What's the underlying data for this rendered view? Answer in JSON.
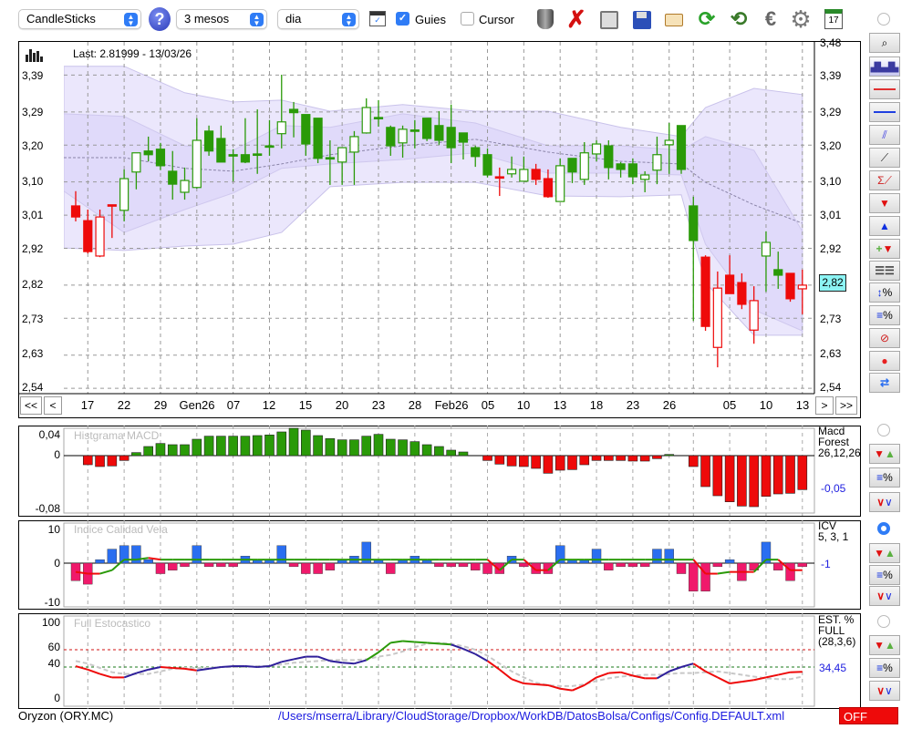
{
  "toolbar": {
    "chart_type": "CandleSticks",
    "period": "3 mesos",
    "interval": "dia",
    "guides_label": "Guies",
    "guides_checked": true,
    "cursor_label": "Cursor",
    "cursor_checked": false,
    "icons": [
      "help-icon",
      "chart-window-icon",
      "trash-icon",
      "delete-icon",
      "snapshot-icon",
      "save-icon",
      "folder-icon",
      "refresh-icon",
      "update-icon",
      "euro-icon",
      "gear-icon",
      "calendar-icon"
    ],
    "calendar_day": "17"
  },
  "main": {
    "last": "Last: 2.81999 - 13/03/26",
    "current_price": "2,82",
    "price_labels": [
      "3,48",
      "3,39",
      "3,29",
      "3,20",
      "3,10",
      "3,01",
      "2,92",
      "2,82",
      "2,73",
      "2,63",
      "2,54"
    ],
    "nav": {
      "first": "<<",
      "prev": "<",
      "next": ">",
      "last": ">>"
    },
    "x_labels": [
      {
        "i": 2,
        "t": "17"
      },
      {
        "i": 5,
        "t": "22"
      },
      {
        "i": 8,
        "t": "29"
      },
      {
        "i": 11,
        "t": "Gen26"
      },
      {
        "i": 14,
        "t": "07"
      },
      {
        "i": 17,
        "t": "12"
      },
      {
        "i": 20,
        "t": "15"
      },
      {
        "i": 23,
        "t": "20"
      },
      {
        "i": 26,
        "t": "23"
      },
      {
        "i": 29,
        "t": "28"
      },
      {
        "i": 32,
        "t": "Feb26"
      },
      {
        "i": 35,
        "t": "05"
      },
      {
        "i": 38,
        "t": "10"
      },
      {
        "i": 41,
        "t": "13"
      },
      {
        "i": 44,
        "t": "18"
      },
      {
        "i": 47,
        "t": "23"
      },
      {
        "i": 50,
        "t": "26"
      },
      {
        "i": 52,
        "t": ""
      },
      {
        "i": 55,
        "t": "05"
      },
      {
        "i": 58,
        "t": "10"
      },
      {
        "i": 61,
        "t": "13"
      }
    ]
  },
  "colors": {
    "up": "#2a9a08",
    "down": "#ee0a0a",
    "band_outer": "#ebe7fc",
    "band_inner": "#e0dafa",
    "icv_pos": "#2a6ef0",
    "icv_neg": "#f0196b",
    "stoch_blue": "#2e1f9a",
    "accent": "#2f7cf6",
    "off": "#ee0a0a"
  },
  "chart_data": [
    {
      "type": "candlestick",
      "title": "CandleSticks",
      "ylim": [
        2.528,
        3.48
      ],
      "candle_format": [
        "open",
        "high",
        "low",
        "close",
        "style"
      ],
      "candles": [
        [
          3.035,
          3.075,
          2.993,
          3.005,
          "r"
        ],
        [
          2.995,
          3.025,
          2.906,
          2.911,
          "r"
        ],
        [
          2.899,
          3.025,
          2.896,
          3.005,
          "rh"
        ],
        [
          3.038,
          3.038,
          2.948,
          3.038,
          "r"
        ],
        [
          3.023,
          3.134,
          2.993,
          3.109,
          "gh"
        ],
        [
          3.127,
          3.179,
          3.08,
          3.179,
          "gh"
        ],
        [
          3.184,
          3.223,
          3.156,
          3.174,
          "g"
        ],
        [
          3.189,
          3.206,
          3.132,
          3.144,
          "g"
        ],
        [
          3.129,
          3.184,
          3.052,
          3.094,
          "g"
        ],
        [
          3.072,
          3.139,
          3.052,
          3.104,
          "gh"
        ],
        [
          3.085,
          3.273,
          3.082,
          3.213,
          "gh"
        ],
        [
          3.238,
          3.253,
          3.171,
          3.184,
          "g"
        ],
        [
          3.218,
          3.253,
          3.154,
          3.154,
          "g"
        ],
        [
          3.174,
          3.189,
          3.102,
          3.174,
          "g"
        ],
        [
          3.174,
          3.273,
          3.151,
          3.154,
          "g"
        ],
        [
          3.176,
          3.297,
          3.122,
          3.176,
          "g"
        ],
        [
          3.198,
          3.268,
          3.171,
          3.198,
          "g"
        ],
        [
          3.231,
          3.391,
          3.191,
          3.263,
          "gh"
        ],
        [
          3.297,
          3.317,
          3.221,
          3.288,
          "g"
        ],
        [
          3.283,
          3.283,
          3.171,
          3.203,
          "g"
        ],
        [
          3.273,
          3.273,
          3.151,
          3.164,
          "g"
        ],
        [
          3.166,
          3.213,
          3.092,
          3.166,
          "g"
        ],
        [
          3.154,
          3.193,
          3.092,
          3.193,
          "gh"
        ],
        [
          3.181,
          3.238,
          3.092,
          3.223,
          "gh"
        ],
        [
          3.233,
          3.327,
          3.231,
          3.302,
          "gh"
        ],
        [
          3.275,
          3.322,
          3.25,
          3.275,
          "g"
        ],
        [
          3.248,
          3.253,
          3.171,
          3.198,
          "g"
        ],
        [
          3.206,
          3.253,
          3.166,
          3.243,
          "gh"
        ],
        [
          3.241,
          3.268,
          3.191,
          3.241,
          "g"
        ],
        [
          3.273,
          3.273,
          3.211,
          3.218,
          "g"
        ],
        [
          3.253,
          3.292,
          3.201,
          3.213,
          "g"
        ],
        [
          3.248,
          3.31,
          3.151,
          3.193,
          "g"
        ],
        [
          3.233,
          3.233,
          3.161,
          3.208,
          "g"
        ],
        [
          3.193,
          3.198,
          3.141,
          3.169,
          "g"
        ],
        [
          3.174,
          3.191,
          3.112,
          3.119,
          "g"
        ],
        [
          3.114,
          3.139,
          3.062,
          3.114,
          "r"
        ],
        [
          3.122,
          3.169,
          3.112,
          3.134,
          "gh"
        ],
        [
          3.102,
          3.169,
          3.102,
          3.134,
          "gh"
        ],
        [
          3.134,
          3.149,
          3.092,
          3.107,
          "r"
        ],
        [
          3.109,
          3.134,
          3.057,
          3.06,
          "r"
        ],
        [
          3.047,
          3.164,
          3.047,
          3.144,
          "gh"
        ],
        [
          3.164,
          3.164,
          3.097,
          3.127,
          "g"
        ],
        [
          3.107,
          3.208,
          3.092,
          3.179,
          "gh"
        ],
        [
          3.176,
          3.213,
          3.156,
          3.203,
          "gh"
        ],
        [
          3.198,
          3.213,
          3.107,
          3.139,
          "g"
        ],
        [
          3.149,
          3.154,
          3.112,
          3.134,
          "g"
        ],
        [
          3.149,
          3.164,
          3.094,
          3.114,
          "g"
        ],
        [
          3.107,
          3.129,
          3.072,
          3.119,
          "gh"
        ],
        [
          3.132,
          3.223,
          3.094,
          3.174,
          "gh"
        ],
        [
          3.201,
          3.26,
          3.122,
          3.213,
          "gh"
        ],
        [
          3.253,
          3.253,
          3.122,
          3.134,
          "g"
        ],
        [
          3.035,
          3.06,
          2.723,
          2.941,
          "g"
        ],
        [
          2.896,
          2.901,
          2.696,
          2.708,
          "r"
        ],
        [
          2.651,
          2.857,
          2.597,
          2.812,
          "rh"
        ],
        [
          2.847,
          2.901,
          2.797,
          2.797,
          "r"
        ],
        [
          2.827,
          2.852,
          2.755,
          2.768,
          "r"
        ],
        [
          2.698,
          2.817,
          2.661,
          2.778,
          "rh"
        ],
        [
          2.899,
          2.966,
          2.802,
          2.936,
          "gh"
        ],
        [
          2.862,
          2.911,
          2.81,
          2.847,
          "g"
        ],
        [
          2.852,
          2.852,
          2.775,
          2.783,
          "r"
        ],
        [
          2.81,
          2.862,
          2.741,
          2.82,
          "rh"
        ]
      ],
      "bands_format": [
        "index",
        "outer_upper",
        "inner_upper",
        "mid",
        "inner_lower",
        "outer_lower"
      ],
      "bands": [
        [
          0,
          3.414,
          3.285,
          3.166,
          3.075,
          2.921
        ],
        [
          5,
          3.414,
          3.278,
          3.166,
          2.963,
          2.914
        ],
        [
          10,
          3.342,
          3.198,
          3.137,
          3.025,
          2.926
        ],
        [
          14,
          3.317,
          3.186,
          3.129,
          3.07,
          2.931
        ],
        [
          18,
          3.322,
          3.253,
          3.149,
          3.137,
          2.963
        ],
        [
          22,
          3.292,
          3.248,
          3.174,
          3.149,
          3.087
        ],
        [
          28,
          3.31,
          3.285,
          3.198,
          3.161,
          3.099
        ],
        [
          34,
          3.292,
          3.26,
          3.216,
          3.179,
          3.099
        ],
        [
          40,
          3.292,
          3.198,
          3.181,
          3.124,
          3.062
        ],
        [
          46,
          3.248,
          3.198,
          3.156,
          3.124,
          3.06
        ],
        [
          51,
          3.223,
          3.186,
          3.149,
          3.119,
          3.065
        ],
        [
          53,
          3.302,
          3.223,
          3.099,
          2.931,
          2.827
        ],
        [
          57,
          3.354,
          3.186,
          3.038,
          2.753,
          2.684
        ],
        [
          61,
          3.337,
          2.966,
          2.988,
          2.696,
          2.684
        ]
      ]
    },
    {
      "type": "bar",
      "title": "Histgrama MACD",
      "legend": [
        "Macd",
        "Forest",
        "26,12,26"
      ],
      "current": "-0,05",
      "tick_labels": [
        {
          "v": 0.04,
          "t": "0,04"
        },
        {
          "v": 0,
          "t": "0"
        },
        {
          "v": -0.08,
          "t": "-0,08"
        }
      ],
      "values": [
        null,
        -0.015,
        -0.018,
        -0.017,
        -0.008,
        0.005,
        0.015,
        0.02,
        0.018,
        0.018,
        0.027,
        0.032,
        0.032,
        0.032,
        0.032,
        0.033,
        0.034,
        0.039,
        0.045,
        0.042,
        0.033,
        0.028,
        0.026,
        0.026,
        0.032,
        0.035,
        0.027,
        0.026,
        0.023,
        0.018,
        0.015,
        0.009,
        0.006,
        0,
        -0.008,
        -0.014,
        -0.017,
        -0.018,
        -0.021,
        -0.029,
        -0.024,
        -0.023,
        -0.015,
        -0.008,
        -0.008,
        -0.008,
        -0.009,
        -0.009,
        -0.005,
        0.002,
        0,
        -0.018,
        -0.051,
        -0.066,
        -0.076,
        -0.083,
        -0.084,
        -0.067,
        -0.063,
        -0.062,
        -0.056
      ]
    },
    {
      "type": "bar",
      "title": "Indice Calidad Vela",
      "legend": [
        "ICV",
        "5, 3, 1"
      ],
      "current": "-1",
      "tick_labels": [
        {
          "v": 10,
          "t": "10"
        },
        {
          "v": 0,
          "t": "0"
        },
        {
          "v": -10,
          "t": "-10"
        }
      ],
      "values": [
        -5,
        -6,
        1,
        4,
        5,
        5,
        1,
        -3,
        -2,
        -1,
        5,
        -1,
        -1,
        -1,
        2,
        1,
        1,
        5,
        -1,
        -3,
        -3,
        -2,
        1,
        2,
        6,
        1,
        -3,
        1,
        2,
        1,
        -1,
        -1,
        -1,
        -2,
        -3,
        -3,
        2,
        -1,
        -3,
        -3,
        5,
        1,
        1,
        4,
        -2,
        -1,
        -1,
        -1,
        4,
        4,
        -3,
        -8,
        -8,
        -1,
        1,
        -5,
        -2,
        6,
        -2,
        -5,
        -1
      ],
      "line": [
        -2.5,
        -3,
        -3,
        -2,
        1,
        1,
        1.5,
        1,
        1,
        1,
        1,
        1,
        1,
        1,
        1,
        1,
        1,
        1,
        1,
        1,
        1,
        1,
        1,
        1,
        1,
        1,
        1,
        1,
        1,
        1,
        1,
        1,
        1,
        1,
        1,
        -2,
        1,
        1,
        -2,
        -2,
        1,
        1,
        1,
        1,
        1,
        1,
        1,
        1,
        1,
        1,
        1,
        1,
        -3,
        -3,
        -2.5,
        -2.5,
        -2.5,
        1,
        1,
        -2,
        -2
      ]
    },
    {
      "type": "line",
      "title": "Full Estocastico",
      "legend": [
        "EST. %",
        "FULL",
        "(28,3,6)"
      ],
      "current": "34,45",
      "ylim": [
        0,
        100
      ],
      "tick_labels": [
        {
          "v": 100,
          "t": "100"
        },
        {
          "v": 60,
          "t": "60"
        },
        {
          "v": 40,
          "t": "40"
        },
        {
          "v": 0,
          "t": "0"
        }
      ],
      "levels": [
        60,
        40
      ],
      "k": [
        41,
        37,
        32,
        28,
        28,
        33,
        37,
        40,
        39,
        38,
        36,
        38,
        40,
        41,
        41,
        40,
        41,
        46,
        49,
        52,
        52,
        47,
        45,
        44,
        48,
        57,
        68,
        70,
        69,
        68,
        67,
        66,
        61,
        55,
        47,
        37,
        26,
        21,
        20,
        19,
        15,
        13,
        19,
        28,
        33,
        34,
        30,
        27,
        27,
        35,
        40,
        44,
        35,
        28,
        21,
        23,
        25,
        28,
        31,
        34,
        34.45
      ],
      "k_colors": [
        "r",
        "r",
        "r",
        "r",
        "r",
        "b",
        "b",
        "b",
        "r",
        "r",
        "r",
        "b",
        "b",
        "b",
        "b",
        "b",
        "b",
        "b",
        "b",
        "b",
        "b",
        "b",
        "b",
        "b",
        "b",
        "g",
        "g",
        "g",
        "g",
        "g",
        "g",
        "g",
        "b",
        "b",
        "b",
        "r",
        "r",
        "r",
        "r",
        "r",
        "r",
        "r",
        "r",
        "r",
        "r",
        "r",
        "r",
        "r",
        "r",
        "b",
        "b",
        "b",
        "r",
        "r",
        "r",
        "r",
        "r",
        "r",
        "r",
        "r",
        "r"
      ],
      "d": [
        47,
        44,
        39,
        34,
        32,
        32,
        32,
        35,
        38,
        39,
        39,
        39,
        40,
        40,
        40,
        41,
        41,
        43,
        45,
        46,
        47,
        48,
        48,
        48,
        49,
        52,
        54,
        58,
        63,
        67,
        68,
        67,
        64,
        60,
        53,
        44,
        35,
        28,
        22,
        19,
        18,
        18,
        20,
        24,
        27,
        29,
        30,
        31,
        31,
        32,
        33,
        33,
        34,
        35,
        33,
        31,
        29,
        27,
        26,
        26,
        29
      ]
    }
  ],
  "status": {
    "symbol": "Oryzon (ORY.MC)",
    "config_path": "/Users/mserra/Library/CloudStorage/Dropbox/WorkDB/DatosBolsa/Configs/Config.DEFAULT.xml",
    "state": "OFF"
  }
}
